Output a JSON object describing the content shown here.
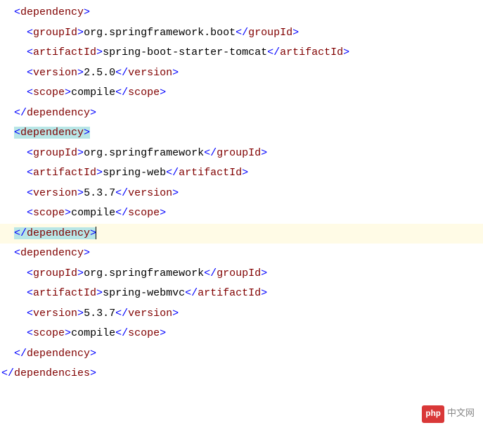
{
  "indent1": "  ",
  "indent2": "    ",
  "dep1": {
    "groupId": "org.springframework.boot",
    "artifactId": "spring-boot-starter-tomcat",
    "version": "2.5.0",
    "scope": "compile"
  },
  "dep2": {
    "groupId": "org.springframework",
    "artifactId": "spring-web",
    "version": "5.3.7",
    "scope": "compile"
  },
  "dep3": {
    "groupId": "org.springframework",
    "artifactId": "spring-webmvc",
    "version": "5.3.7",
    "scope": "compile"
  },
  "tags": {
    "dependency": "dependency",
    "groupId": "groupId",
    "artifactId": "artifactId",
    "version": "version",
    "scope": "scope",
    "dependencies": "dependencies"
  },
  "watermark": {
    "logo": "php",
    "text": "中文网"
  }
}
